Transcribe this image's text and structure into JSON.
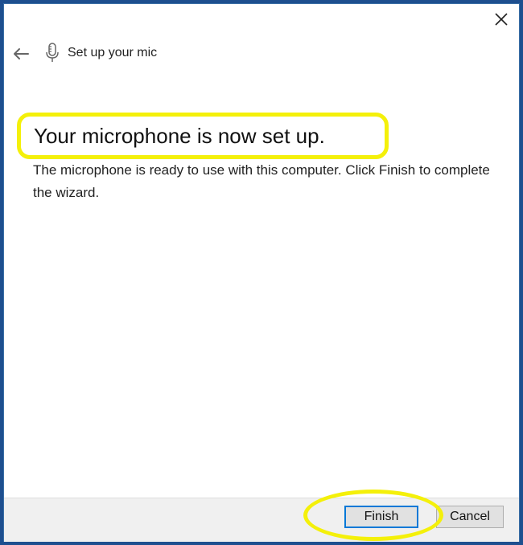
{
  "header": {
    "title": "Set up your mic",
    "back_icon": "arrow-left-icon",
    "mic_icon": "microphone-icon",
    "close_icon": "close-icon"
  },
  "content": {
    "heading": "Your microphone is now set up.",
    "description": "The microphone is ready to use with this computer. Click Finish to complete the wizard."
  },
  "footer": {
    "finish_label": "Finish",
    "cancel_label": "Cancel"
  },
  "colors": {
    "highlight": "#f4f00a",
    "accent": "#0078d7",
    "desktop": "#1e4f8f"
  }
}
